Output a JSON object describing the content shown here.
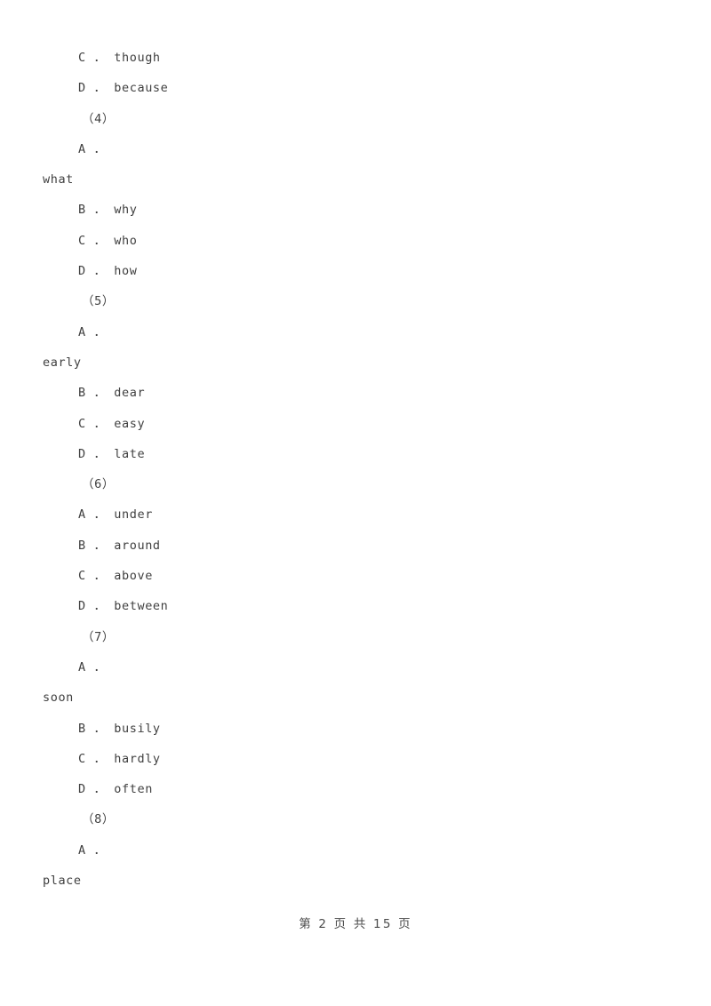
{
  "document": {
    "lines": [
      {
        "id": "q3-opt-c",
        "indent": "option",
        "text": "C ． though"
      },
      {
        "id": "q3-opt-d",
        "indent": "option",
        "text": "D ． because"
      },
      {
        "id": "q4-number",
        "indent": "number",
        "text": "（4）"
      },
      {
        "id": "q4-opt-a",
        "indent": "option",
        "text": "A ．"
      },
      {
        "id": "q4-opt-a-wrap",
        "indent": "margin",
        "text": "what"
      },
      {
        "id": "q4-opt-b",
        "indent": "option",
        "text": "B ． why"
      },
      {
        "id": "q4-opt-c",
        "indent": "option",
        "text": "C ． who"
      },
      {
        "id": "q4-opt-d",
        "indent": "option",
        "text": "D ． how"
      },
      {
        "id": "q5-number",
        "indent": "number",
        "text": "（5）"
      },
      {
        "id": "q5-opt-a",
        "indent": "option",
        "text": "A ．"
      },
      {
        "id": "q5-opt-a-wrap",
        "indent": "margin",
        "text": "early"
      },
      {
        "id": "q5-opt-b",
        "indent": "option",
        "text": "B ． dear"
      },
      {
        "id": "q5-opt-c",
        "indent": "option",
        "text": "C ． easy"
      },
      {
        "id": "q5-opt-d",
        "indent": "option",
        "text": "D ． late"
      },
      {
        "id": "q6-number",
        "indent": "number",
        "text": "（6）"
      },
      {
        "id": "q6-opt-a",
        "indent": "option",
        "text": "A ． under"
      },
      {
        "id": "q6-opt-b",
        "indent": "option",
        "text": "B ． around"
      },
      {
        "id": "q6-opt-c",
        "indent": "option",
        "text": "C ． above"
      },
      {
        "id": "q6-opt-d",
        "indent": "option",
        "text": "D ． between"
      },
      {
        "id": "q7-number",
        "indent": "number",
        "text": "（7）"
      },
      {
        "id": "q7-opt-a",
        "indent": "option",
        "text": "A ．"
      },
      {
        "id": "q7-opt-a-wrap",
        "indent": "margin",
        "text": "soon"
      },
      {
        "id": "q7-opt-b",
        "indent": "option",
        "text": "B ． busily"
      },
      {
        "id": "q7-opt-c",
        "indent": "option",
        "text": "C ． hardly"
      },
      {
        "id": "q7-opt-d",
        "indent": "option",
        "text": "D ． often"
      },
      {
        "id": "q8-number",
        "indent": "number",
        "text": "（8）"
      },
      {
        "id": "q8-opt-a",
        "indent": "option",
        "text": "A ．"
      },
      {
        "id": "q8-opt-a-wrap",
        "indent": "margin",
        "text": "place"
      }
    ]
  },
  "footer": {
    "page_indicator": "第 2 页 共 15 页",
    "current_page": "2",
    "total_pages": "15"
  },
  "colors": {
    "page_background": "#ffffff",
    "body_text": "#3f3f3f",
    "footer_text": "#4a4a4a"
  }
}
